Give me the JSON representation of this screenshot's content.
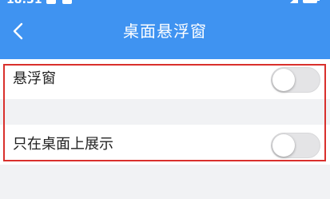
{
  "status_bar": {
    "time": "18:31"
  },
  "header": {
    "back_icon": "chevron-left-icon",
    "title": "桌面悬浮窗",
    "background_color": "#3f93f1"
  },
  "settings": [
    {
      "label": "悬浮窗",
      "enabled": false
    },
    {
      "label": "只在桌面上展示",
      "enabled": false
    }
  ],
  "highlight": {
    "color": "#d9302c"
  }
}
